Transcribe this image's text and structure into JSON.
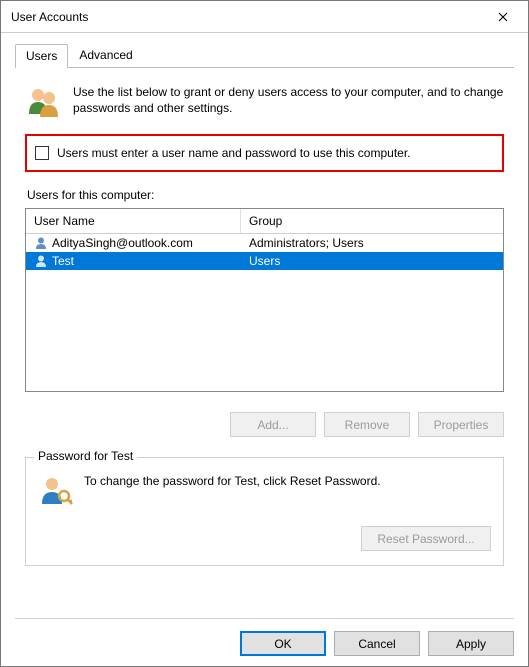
{
  "window": {
    "title": "User Accounts"
  },
  "tabs": {
    "users": "Users",
    "advanced": "Advanced"
  },
  "intro": "Use the list below to grant or deny users access to your computer, and to change passwords and other settings.",
  "checkbox": {
    "label": "Users must enter a user name and password to use this computer."
  },
  "users_section": {
    "label": "Users for this computer:",
    "columns": {
      "name": "User Name",
      "group": "Group"
    },
    "rows": [
      {
        "name": "AdityaSingh@outlook.com",
        "group": "Administrators; Users",
        "selected": false
      },
      {
        "name": "Test",
        "group": "Users",
        "selected": true
      }
    ]
  },
  "buttons": {
    "add": "Add...",
    "remove": "Remove",
    "properties": "Properties"
  },
  "password_section": {
    "legend": "Password for Test",
    "text": "To change the password for Test, click Reset Password.",
    "reset": "Reset Password..."
  },
  "dialog_buttons": {
    "ok": "OK",
    "cancel": "Cancel",
    "apply": "Apply"
  }
}
